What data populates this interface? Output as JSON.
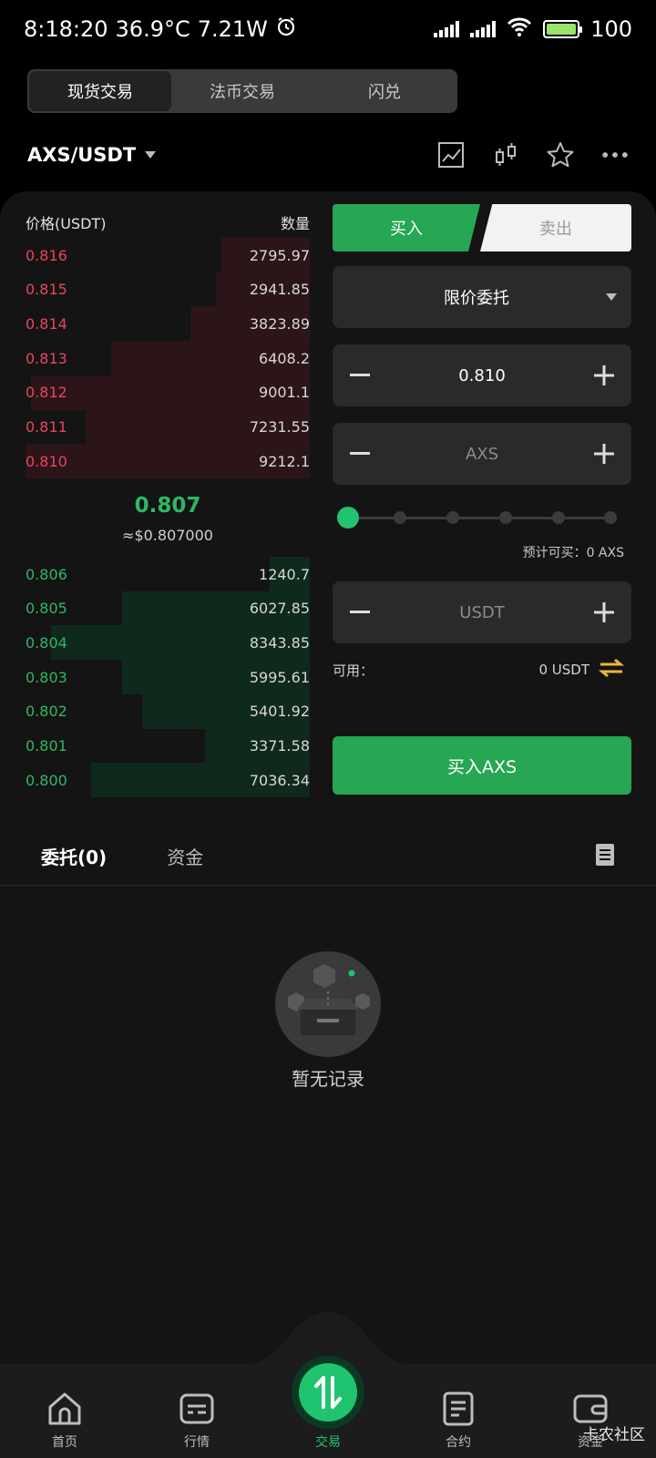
{
  "status": {
    "time": "8:18:20",
    "temp": "36.9°C",
    "power": "7.21W",
    "battery": "100"
  },
  "top_tabs": [
    {
      "label": "现货交易",
      "active": true
    },
    {
      "label": "法币交易",
      "active": false
    },
    {
      "label": "闪兑",
      "active": false
    }
  ],
  "pair": "AXS/USDT",
  "orderbook": {
    "price_header": "价格(USDT)",
    "qty_header": "数量",
    "asks": [
      {
        "price": "0.816",
        "qty": "2795.97",
        "depth": 0.31
      },
      {
        "price": "0.815",
        "qty": "2941.85",
        "depth": 0.33
      },
      {
        "price": "0.814",
        "qty": "3823.89",
        "depth": 0.42
      },
      {
        "price": "0.813",
        "qty": "6408.2",
        "depth": 0.7
      },
      {
        "price": "0.812",
        "qty": "9001.1",
        "depth": 0.98
      },
      {
        "price": "0.811",
        "qty": "7231.55",
        "depth": 0.79
      },
      {
        "price": "0.810",
        "qty": "9212.1",
        "depth": 1.0
      }
    ],
    "mid_price": "0.807",
    "mid_usd": "≈$0.807000",
    "bids": [
      {
        "price": "0.806",
        "qty": "1240.7",
        "depth": 0.14
      },
      {
        "price": "0.805",
        "qty": "6027.85",
        "depth": 0.66
      },
      {
        "price": "0.804",
        "qty": "8343.85",
        "depth": 0.91
      },
      {
        "price": "0.803",
        "qty": "5995.61",
        "depth": 0.66
      },
      {
        "price": "0.802",
        "qty": "5401.92",
        "depth": 0.59
      },
      {
        "price": "0.801",
        "qty": "3371.58",
        "depth": 0.37
      },
      {
        "price": "0.800",
        "qty": "7036.34",
        "depth": 0.77
      }
    ]
  },
  "form": {
    "buy_tab": "买入",
    "sell_tab": "卖出",
    "order_type": "限价委托",
    "price_value": "0.810",
    "amount_placeholder": "AXS",
    "total_placeholder": "USDT",
    "slider_percent": 0,
    "estimate": "预计可买：0  AXS",
    "available_label": "可用：",
    "available_amount": "0  USDT",
    "buy_button": "买入AXS"
  },
  "orders_tabs": [
    {
      "label": "委托(0)",
      "active": true
    },
    {
      "label": "资金",
      "active": false
    }
  ],
  "empty_text": "暂无记录",
  "nav": [
    {
      "label": "首页",
      "icon": "home-icon"
    },
    {
      "label": "行情",
      "icon": "market-icon"
    },
    {
      "label": "交易",
      "icon": "trade-icon"
    },
    {
      "label": "合约",
      "icon": "contract-icon"
    },
    {
      "label": "资金",
      "icon": "wallet-icon"
    }
  ],
  "watermark": "卡农社区",
  "colors": {
    "buy_green": "#27a654",
    "sell_red": "#e9455d",
    "accent_green": "#21c46e"
  }
}
